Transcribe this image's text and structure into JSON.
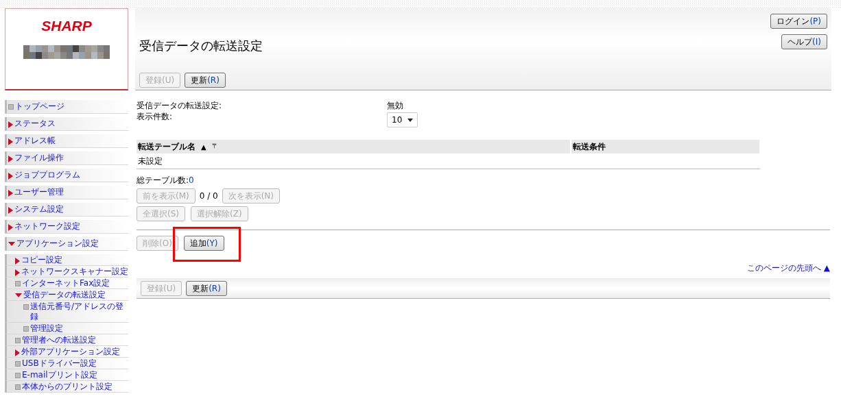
{
  "logo": {
    "text": "SHARP"
  },
  "sidebar": {
    "items": [
      {
        "label": "トップページ",
        "kind": "page"
      },
      {
        "label": "ステータス",
        "kind": "folder",
        "expanded": false
      },
      {
        "label": "アドレス帳",
        "kind": "folder",
        "expanded": false
      },
      {
        "label": "ファイル操作",
        "kind": "folder",
        "expanded": false
      },
      {
        "label": "ジョブプログラム",
        "kind": "folder",
        "expanded": false
      },
      {
        "label": "ユーザー管理",
        "kind": "folder",
        "expanded": false
      },
      {
        "label": "システム設定",
        "kind": "folder",
        "expanded": false
      },
      {
        "label": "ネットワーク設定",
        "kind": "folder",
        "expanded": false
      },
      {
        "label": "アプリケーション設定",
        "kind": "folder",
        "expanded": true,
        "children": [
          {
            "label": "コピー設定",
            "kind": "folder",
            "expanded": false
          },
          {
            "label": "ネットワークスキャナー設定",
            "kind": "folder",
            "expanded": false
          },
          {
            "label": "インターネットFax設定",
            "kind": "page"
          },
          {
            "label": "受信データの転送設定",
            "kind": "folder",
            "expanded": true,
            "children": [
              {
                "label": "送信元番号/アドレスの登録",
                "kind": "page"
              },
              {
                "label": "管理設定",
                "kind": "page"
              }
            ]
          },
          {
            "label": "管理者への転送設定",
            "kind": "page"
          },
          {
            "label": "外部アプリケーション設定",
            "kind": "folder",
            "expanded": false
          },
          {
            "label": "USBドライバー設定",
            "kind": "page"
          },
          {
            "label": "E-mailプリント設定",
            "kind": "page"
          },
          {
            "label": "本体からのプリント設定",
            "kind": "page"
          }
        ]
      }
    ]
  },
  "header": {
    "title": "受信データの転送設定",
    "buttons": [
      {
        "label": "ログイン",
        "key": "(P)",
        "disabled": false
      },
      {
        "label": "ヘルプ",
        "key": "(I)",
        "disabled": false
      }
    ]
  },
  "top_toolbar": [
    {
      "label": "登録",
      "key": "(U)",
      "disabled": true
    },
    {
      "label": "更新",
      "key": "(R)",
      "disabled": false
    }
  ],
  "settings": [
    {
      "label": "受信データの転送設定:",
      "kind": "text",
      "value": "無効"
    },
    {
      "label": "表示件数:",
      "kind": "select",
      "value": "10"
    }
  ],
  "table": {
    "columns": [
      {
        "label": "転送テーブル名",
        "sort": "▲",
        "filter": "〒"
      },
      {
        "label": "転送条件"
      }
    ],
    "rows": [
      [
        "未設定",
        ""
      ]
    ]
  },
  "total": {
    "label": "総テーブル数:",
    "value": "0"
  },
  "pager": {
    "prev": {
      "label": "前を表示",
      "key": "(M)",
      "disabled": true
    },
    "count": "0 / 0",
    "next": {
      "label": "次を表示",
      "key": "(N)",
      "disabled": true
    }
  },
  "selection_buttons": [
    {
      "label": "全選択",
      "key": "(S)",
      "disabled": true
    },
    {
      "label": "選択解除",
      "key": "(Z)",
      "disabled": true
    }
  ],
  "action_buttons": [
    {
      "label": "削除",
      "key": "(O)",
      "disabled": true,
      "highlighted": false
    },
    {
      "label": "追加",
      "key": "(Y)",
      "disabled": false,
      "highlighted": true
    }
  ],
  "top_link": "このページの先頭へ ▲",
  "bottom_toolbar": [
    {
      "label": "登録",
      "key": "(U)",
      "disabled": true
    },
    {
      "label": "更新",
      "key": "(R)",
      "disabled": false
    }
  ]
}
